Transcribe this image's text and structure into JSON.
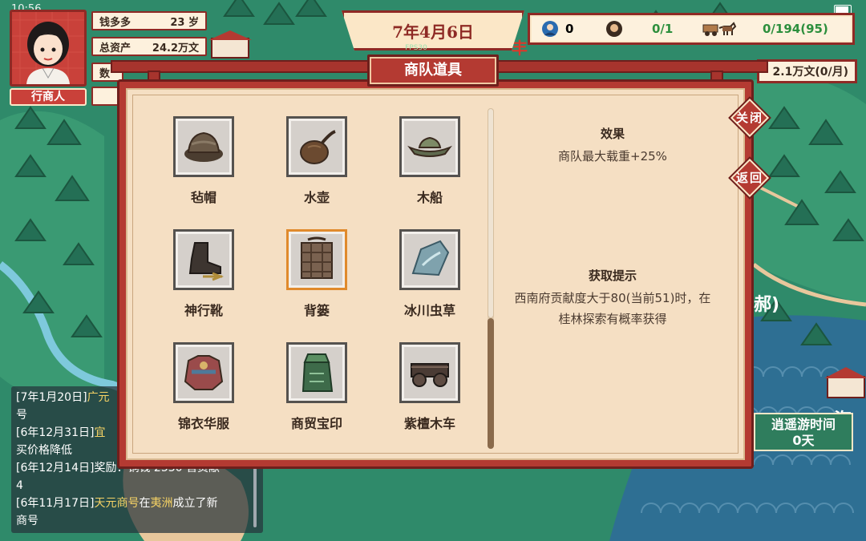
{
  "status": {
    "clock": "10:56"
  },
  "player": {
    "name": "钱多多",
    "age": "23 岁",
    "total_assets_label": "总资产",
    "total_assets_value": "24.2万文",
    "row3_label": "数",
    "role": "行商人"
  },
  "date": {
    "text": "7年4月6日",
    "fps": "FPS30"
  },
  "resources": {
    "scholars": "0",
    "workers": "0/1",
    "caravan": "0/194(95)",
    "money": "2.1万文(0/月)",
    "map_label": "丰"
  },
  "dialog": {
    "title": "商队道具",
    "close_label": "关闭",
    "back_label": "返回",
    "items": [
      {
        "label": "毡帽",
        "icon": "felt-hat-icon"
      },
      {
        "label": "水壶",
        "icon": "water-flask-icon"
      },
      {
        "label": "木船",
        "icon": "wooden-boat-icon"
      },
      {
        "label": "神行靴",
        "icon": "swift-boots-icon"
      },
      {
        "label": "背篓",
        "icon": "back-basket-icon"
      },
      {
        "label": "冰川虫草",
        "icon": "glacier-cordyceps-icon"
      },
      {
        "label": "锦衣华服",
        "icon": "brocade-robe-icon"
      },
      {
        "label": "商贸宝印",
        "icon": "trade-seal-icon"
      },
      {
        "label": "紫檀木车",
        "icon": "rosewood-cart-icon"
      }
    ],
    "selected_index": 4,
    "effect_title": "效果",
    "effect_text": "商队最大载重+25%",
    "hint_title": "获取提示",
    "hint_text_line1": "西南府贡献度大于80(当前51)时，在",
    "hint_text_line2": "桂林探索有概率获得"
  },
  "log": {
    "lines": [
      {
        "date": "[7年1月20日]",
        "hl": "广元",
        "rest": ""
      },
      {
        "text": "号"
      },
      {
        "date": "[6年12月31日]",
        "hl": "宜",
        "rest": ""
      },
      {
        "text": "买价格降低"
      },
      {
        "date": "[6年12月14日]",
        "rest": "奖励：铜钱 2530 官贡献"
      },
      {
        "text": "4"
      },
      {
        "date": "[6年11月17日]",
        "hl": "天元商号",
        "mid": "在",
        "hl2": "夷洲",
        "rest": "成立了新"
      },
      {
        "text": "商号"
      }
    ]
  },
  "wander": {
    "label": "逍遥游时间",
    "value": "0天"
  },
  "map_labels": {
    "city_right": "海",
    "paren": "郝)"
  },
  "colors": {
    "accent": "#b43a32",
    "panel": "#f5dfc3",
    "map": "#2f8a6a",
    "highlight": "#e08a2c"
  }
}
